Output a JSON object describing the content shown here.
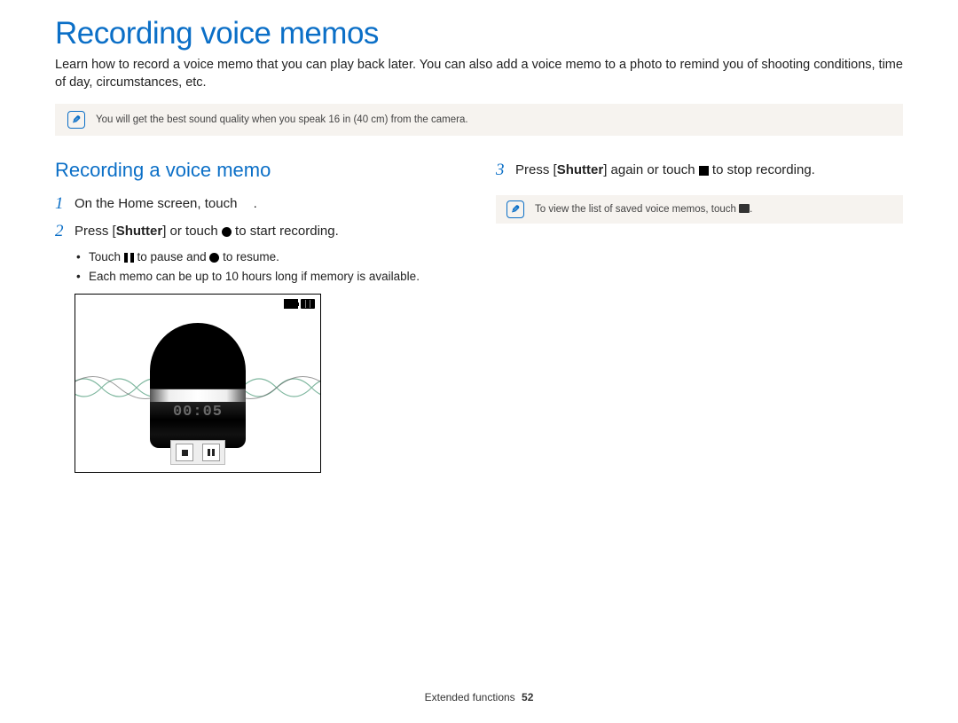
{
  "title": "Recording voice memos",
  "intro": "Learn how to record a voice memo that you can play back later. You can also add a voice memo to a photo to remind you of shooting conditions, time of day, circumstances, etc.",
  "note1": "You will get the best sound quality when you speak 16 in (40 cm) from the camera.",
  "section_title": "Recording a voice memo",
  "step1_num": "1",
  "step1_pre": "On the Home screen, touch ",
  "step1_post": ".",
  "step2_num": "2",
  "step2_pre": "Press [",
  "step2_shutter": "Shutter",
  "step2_mid": "] or touch ",
  "step2_post": " to start recording.",
  "bullet_a_pre": "Touch ",
  "bullet_a_mid": " to pause and ",
  "bullet_a_post": " to resume.",
  "bullet_b": "Each memo can be up to 10 hours long if memory is available.",
  "illus_timer": "00:05",
  "step3_num": "3",
  "step3_pre": "Press [",
  "step3_shutter": "Shutter",
  "step3_mid": "] again or touch ",
  "step3_post": " to stop recording.",
  "note2_pre": "To view the list of saved voice memos, touch ",
  "note2_post": ".",
  "footer_section": "Extended functions",
  "footer_page": "52"
}
